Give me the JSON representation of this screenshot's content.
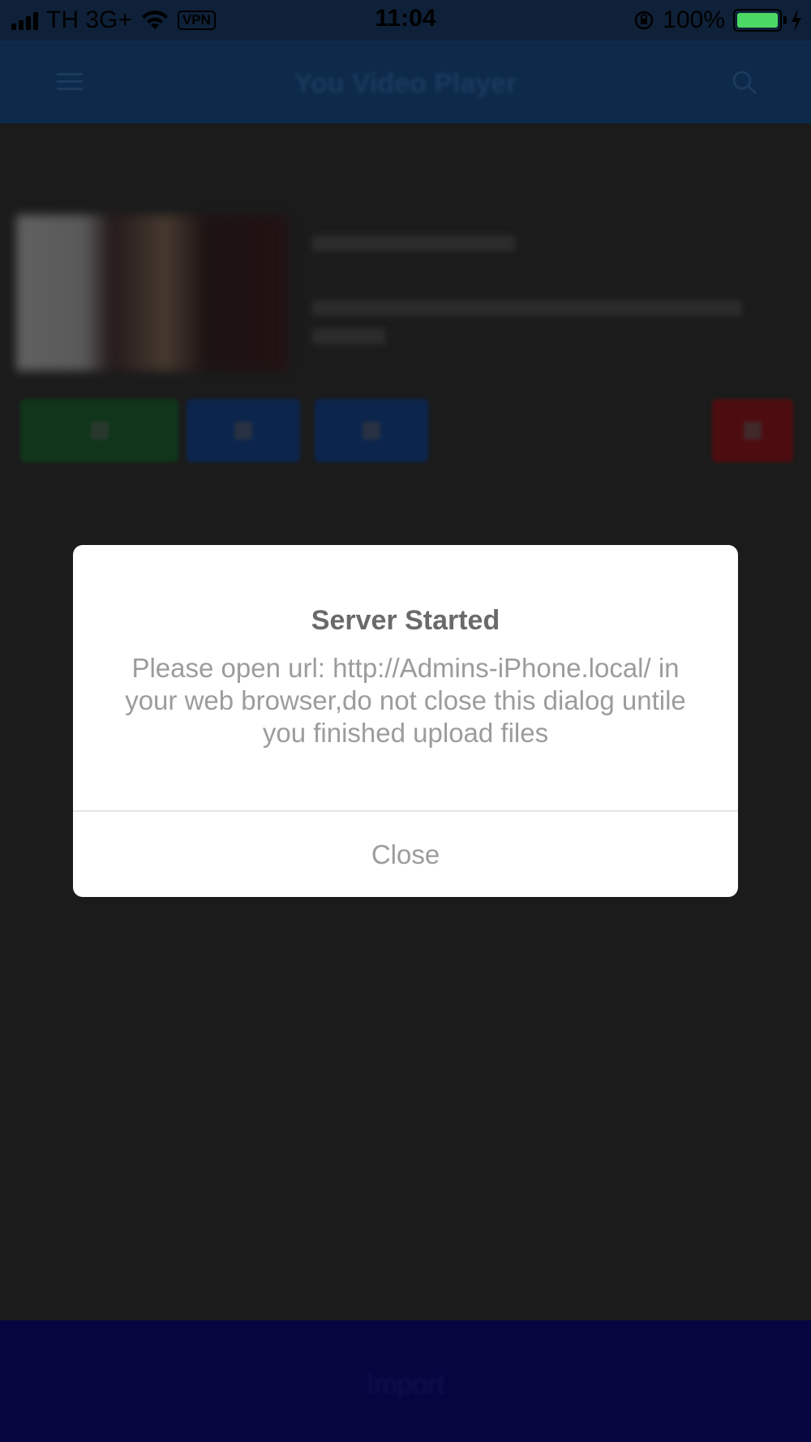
{
  "status_bar": {
    "carrier": "TH 3G+",
    "vpn": "VPN",
    "time": "11:04",
    "battery": "100%",
    "battery_color": "#4cd864"
  },
  "navbar": {
    "title": "You Video Player",
    "left_icon": "menu-icon",
    "right_icon": "search-icon",
    "color": "#0d2a4a"
  },
  "content": {
    "actions": [
      {
        "name": "play",
        "color": "#10351a"
      },
      {
        "name": "share",
        "color": "#0c254d"
      },
      {
        "name": "download",
        "color": "#0c254d"
      },
      {
        "name": "delete",
        "color": "#4d0d10"
      }
    ]
  },
  "bottom_bar": {
    "label": "Import",
    "color": "#050540"
  },
  "dialog": {
    "title": "Server Started",
    "message": "Please open url: http://Admins-iPhone.local/ in your web browser,do not close this dialog untile you finished upload files",
    "close_label": "Close"
  }
}
